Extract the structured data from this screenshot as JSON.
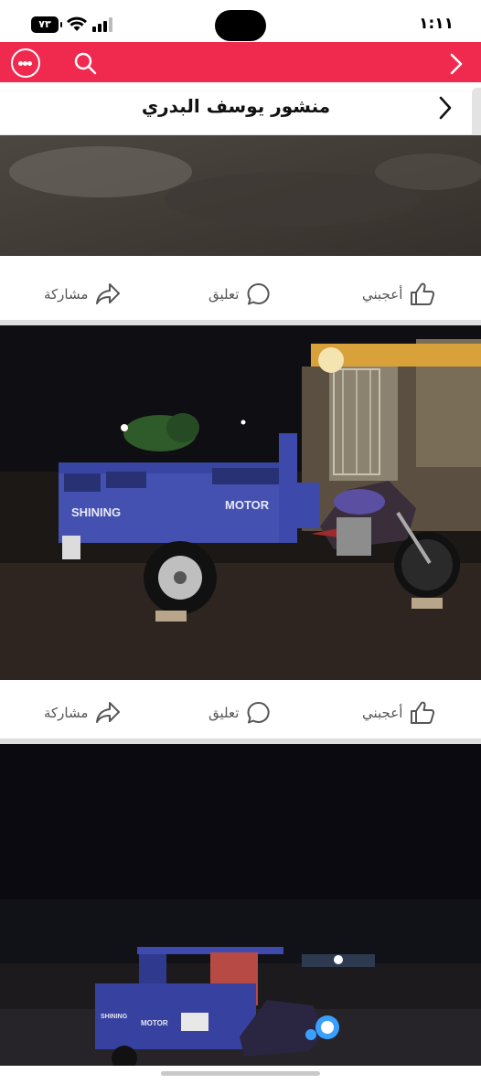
{
  "status": {
    "time": "١:١١",
    "battery": "٧٣"
  },
  "header": {
    "title": "منشور يوسف البدري"
  },
  "post_actions": {
    "like": "أعجبني",
    "comment": "تعليق",
    "share": "مشاركة"
  },
  "photo2": {
    "cart_text_left": "SHINING",
    "cart_text_right": "MOTOR"
  },
  "photo3": {
    "cart_text_left": "SHINING",
    "cart_text_right": "MOTOR"
  }
}
